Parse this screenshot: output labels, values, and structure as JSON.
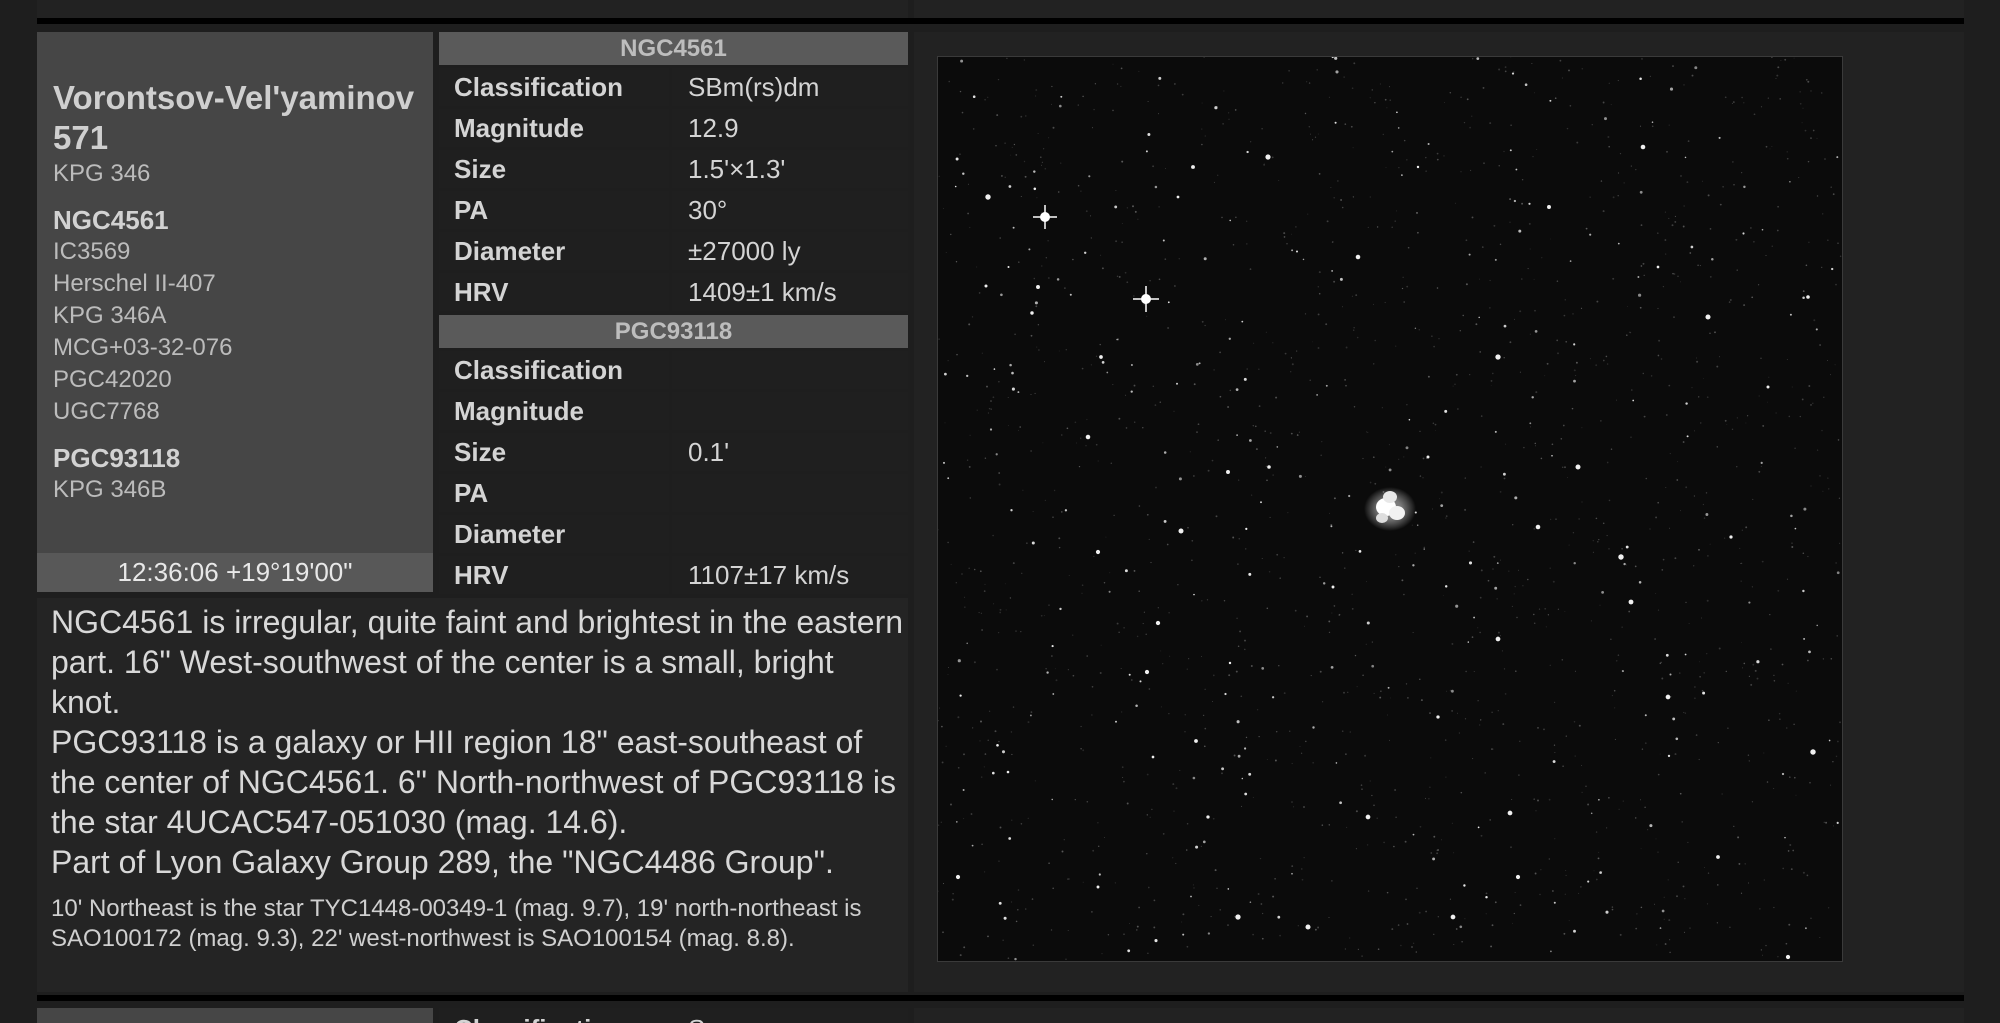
{
  "name_panel": {
    "title": "Vorontsov-Vel'yaminov 571",
    "title_alias": "KPG 346",
    "objects": [
      {
        "heading": "NGC4561",
        "aliases": [
          "IC3569",
          "Herschel II-407",
          "KPG 346A",
          "MCG+03-32-076",
          "PGC42020",
          "UGC7768"
        ]
      },
      {
        "heading": "PGC93118",
        "aliases": [
          "KPG 346B"
        ]
      }
    ],
    "coordinates": "12:36:06 +19°19'00\""
  },
  "tables": [
    {
      "title": "NGC4561",
      "rows": [
        {
          "key": "Classification",
          "value": "SBm(rs)dm"
        },
        {
          "key": "Magnitude",
          "value": "12.9"
        },
        {
          "key": "Size",
          "value": "1.5'×1.3'"
        },
        {
          "key": "PA",
          "value": "30°"
        },
        {
          "key": "Diameter",
          "value": "±27000 ly"
        },
        {
          "key": "HRV",
          "value": "1409±1 km/s"
        }
      ]
    },
    {
      "title": "PGC93118",
      "rows": [
        {
          "key": "Classification",
          "value": ""
        },
        {
          "key": "Magnitude",
          "value": ""
        },
        {
          "key": "Size",
          "value": "0.1'"
        },
        {
          "key": "PA",
          "value": ""
        },
        {
          "key": "Diameter",
          "value": ""
        },
        {
          "key": "HRV",
          "value": "1107±17 km/s"
        }
      ]
    }
  ],
  "description": {
    "paragraphs": [
      "NGC4561 is irregular, quite faint and brightest in the eastern part. 16\" West-southwest of the center is a small, bright knot.",
      "PGC93118 is a galaxy or HII region 18\" east-southeast of the center of NGC4561. 6\" North-northwest of PGC93118 is the star 4UCAC547-051030 (mag. 14.6).",
      "Part of Lyon Galaxy Group 289, the \"NGC4486 Group\"."
    ],
    "note": "10' Northeast is the star TYC1448-00349-1 (mag. 9.7), 19' north-northeast is SAO100172 (mag. 9.3), 22' west-northwest is SAO100154 (mag. 8.8)."
  },
  "next_record": {
    "first_key": "Classification",
    "first_value": "Sc"
  }
}
